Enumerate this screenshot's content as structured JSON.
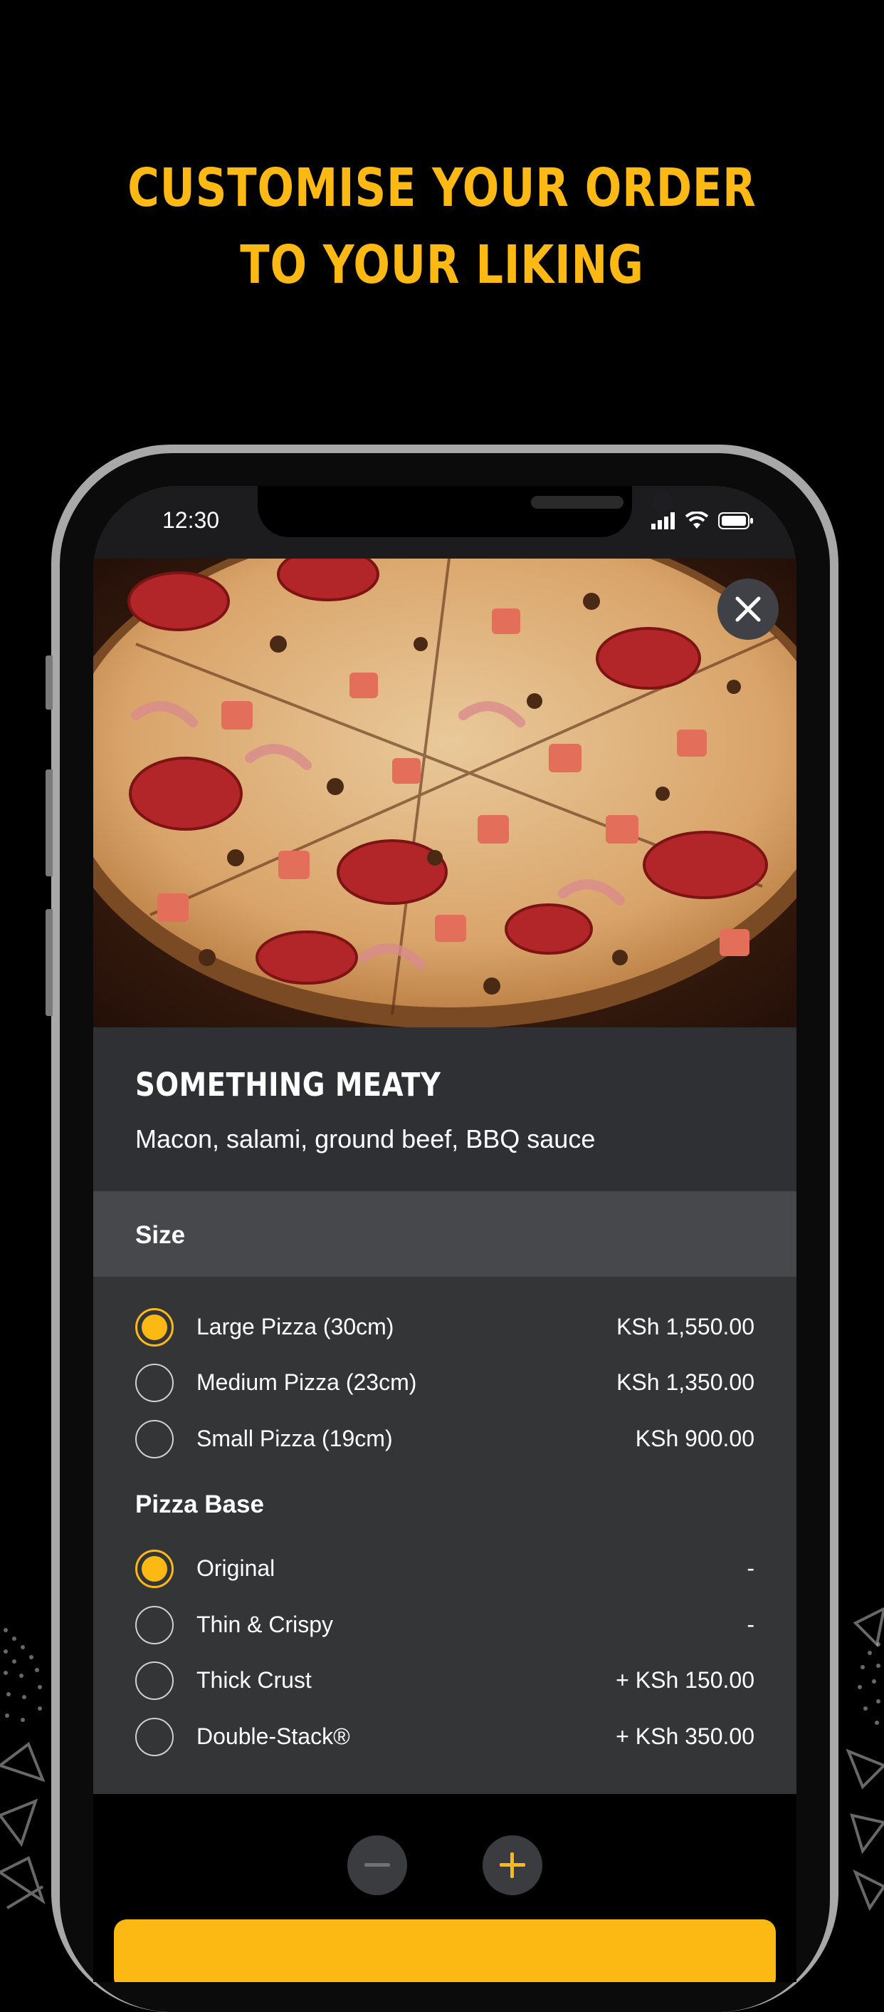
{
  "headline": {
    "line1": "CUSTOMISE YOUR ORDER",
    "line2": "TO YOUR LIKING"
  },
  "statusbar": {
    "time": "12:30"
  },
  "product": {
    "title": "SOMETHING MEATY",
    "description": "Macon, salami, ground beef, BBQ sauce"
  },
  "size": {
    "header": "Size",
    "options": [
      {
        "label": "Large Pizza (30cm)",
        "price": "KSh 1,550.00",
        "selected": true
      },
      {
        "label": "Medium Pizza (23cm)",
        "price": "KSh 1,350.00",
        "selected": false
      },
      {
        "label": "Small Pizza (19cm)",
        "price": "KSh 900.00",
        "selected": false
      }
    ]
  },
  "base": {
    "title": "Pizza Base",
    "options": [
      {
        "label": "Original",
        "price": "-",
        "selected": true
      },
      {
        "label": "Thin & Crispy",
        "price": "-",
        "selected": false
      },
      {
        "label": "Thick Crust",
        "price": "+ KSh 150.00",
        "selected": false
      },
      {
        "label": "Double-Stack®",
        "price": "+ KSh 350.00",
        "selected": false
      }
    ]
  },
  "colors": {
    "accent": "#FDB913",
    "background": "#000000",
    "panel": "#333537",
    "header": "#46484C"
  },
  "icons": {
    "close": "close-icon",
    "minus": "minus-icon",
    "plus": "plus-icon",
    "signal": "signal-icon",
    "wifi": "wifi-icon",
    "battery": "battery-icon"
  }
}
